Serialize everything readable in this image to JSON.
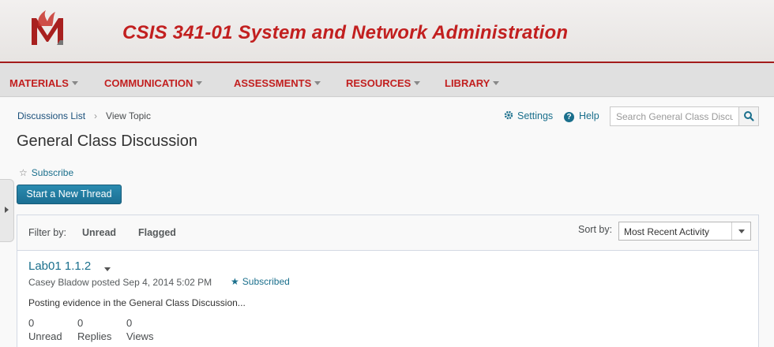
{
  "header": {
    "course_title": "CSIS 341-01 System and Network Administration",
    "brand_color": "#c21f1f"
  },
  "nav": {
    "items": [
      {
        "label": "MATERIALS"
      },
      {
        "label": "COMMUNICATION"
      },
      {
        "label": "ASSESSMENTS"
      },
      {
        "label": "RESOURCES"
      },
      {
        "label": "LIBRARY"
      }
    ],
    "caret_icon": "chevron-down-icon"
  },
  "breadcrumb": {
    "parent": "Discussions List",
    "current": "View Topic"
  },
  "page_title": "General Class Discussion",
  "toolbar": {
    "settings_label": "Settings",
    "help_label": "Help",
    "search_placeholder": "Search General Class Discussion",
    "search_icon": "search-icon"
  },
  "subscribe_label": "Subscribe",
  "new_thread_label": "Start a New Thread",
  "filter": {
    "label": "Filter by:",
    "options": [
      "Unread",
      "Flagged"
    ],
    "sort_label": "Sort by:",
    "sort_value": "Most Recent Activity"
  },
  "thread": {
    "title": "Lab01 1.1.2",
    "meta": "Casey Bladow posted Sep 4, 2014 5:02 PM",
    "subscribed_label": "Subscribed",
    "excerpt": "Posting evidence in the General Class Discussion...",
    "stats": [
      {
        "value": "0",
        "label": "Unread"
      },
      {
        "value": "0",
        "label": "Replies"
      },
      {
        "value": "0",
        "label": "Views"
      }
    ]
  },
  "colors": {
    "link": "#1a6f8c",
    "button": "#1c6f93"
  }
}
